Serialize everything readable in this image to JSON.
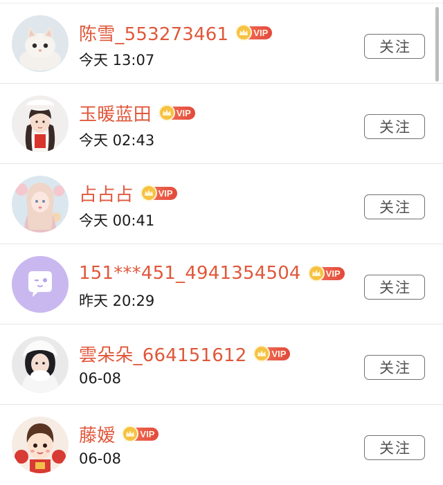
{
  "colors": {
    "name": "#e0573a",
    "vip_badge": "#e24a3a",
    "crown": "#f6c243",
    "time": "#1a1a1a",
    "button_border": "#707070"
  },
  "vip_label": "VIP",
  "follow_label": "关注",
  "users": [
    {
      "name": "陈雪_553273461",
      "time": "今天 13:07",
      "avatar": "kitten-avatar",
      "vip": true
    },
    {
      "name": "玉暖蓝田",
      "time": "今天 02:43",
      "avatar": "girl-red-scarf-avatar",
      "vip": true
    },
    {
      "name": "占占占",
      "time": "今天 00:41",
      "avatar": "pastel-girl-avatar",
      "vip": true
    },
    {
      "name": "151***451_4941354504",
      "time": "昨天 20:29",
      "avatar": "default-chat-avatar",
      "vip": true
    },
    {
      "name": "雲朵朵_664151612",
      "time": "06-08",
      "avatar": "girl-white-hat-avatar",
      "vip": true
    },
    {
      "name": "藤嫒",
      "time": "06-08",
      "avatar": "cartoon-child-avatar",
      "vip": true
    }
  ]
}
